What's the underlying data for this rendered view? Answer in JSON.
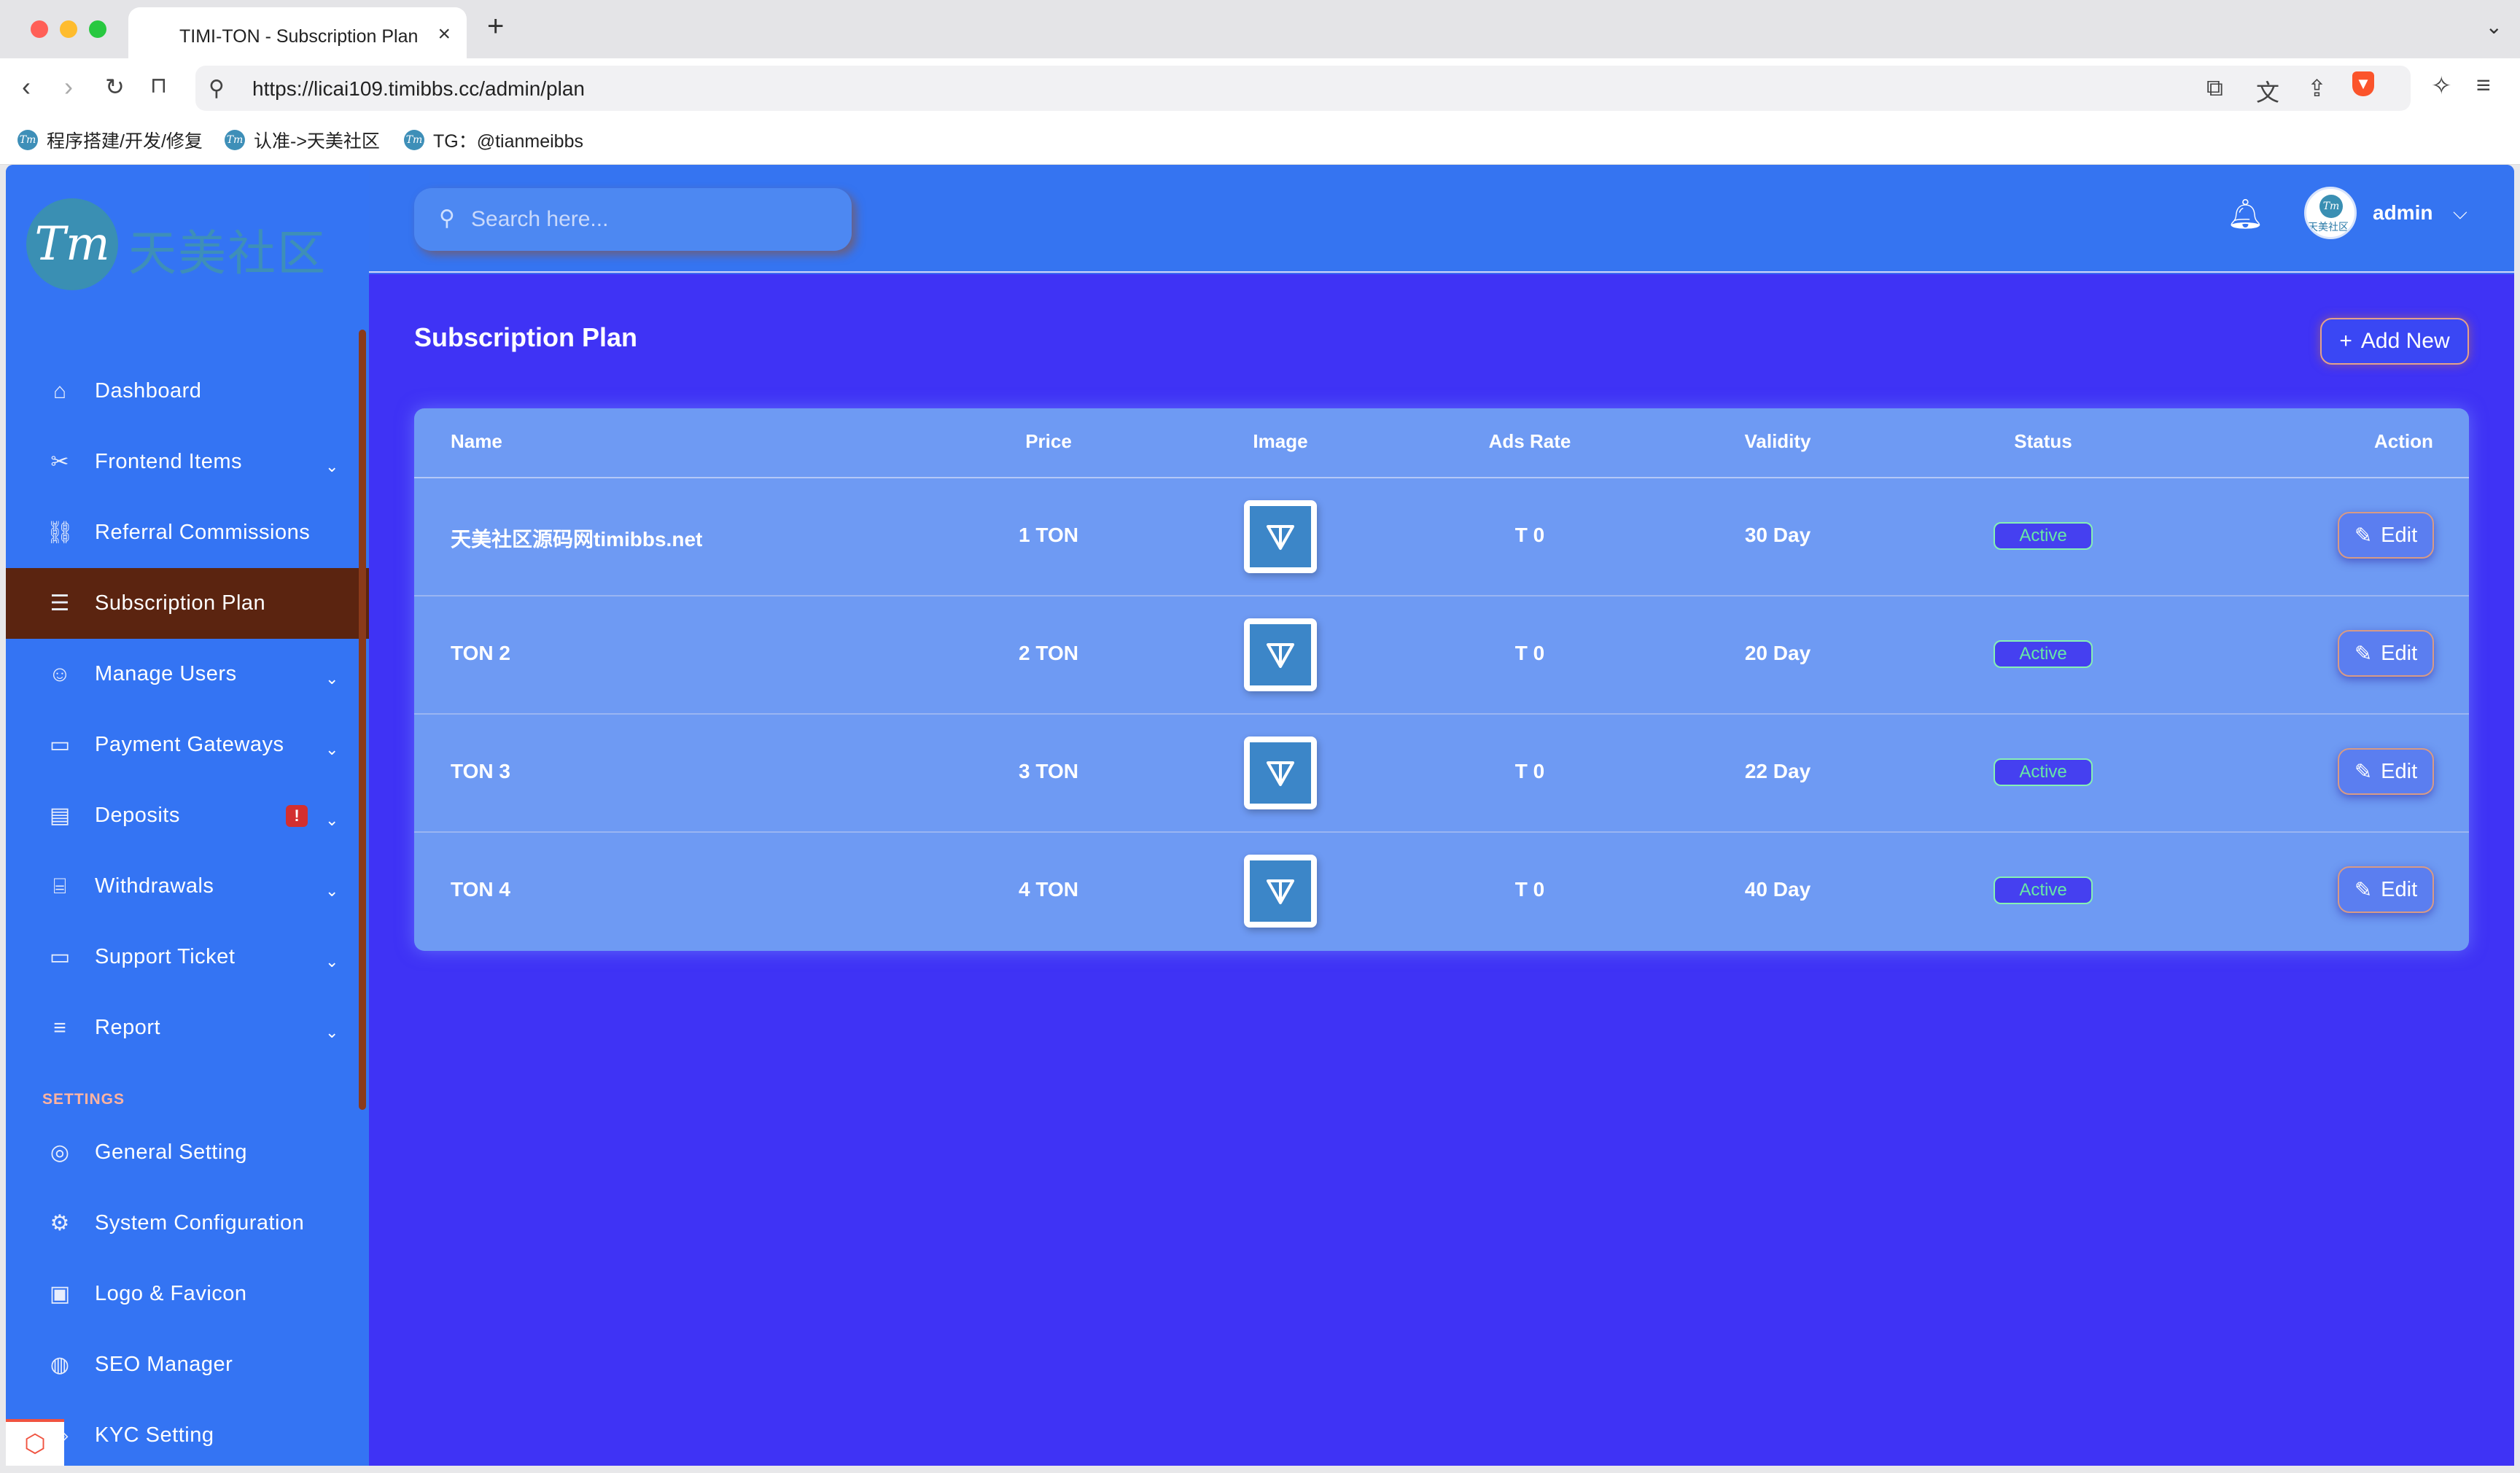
{
  "browser": {
    "tab_title": "TIMI-TON - Subscription Plan",
    "url": "https://licai109.timibbs.cc/admin/plan",
    "bookmarks": [
      "程序搭建/开发/修复",
      "认准->天美社区",
      "TG：@tianmeibbs"
    ]
  },
  "brand": {
    "logo_text": "天美社区",
    "logo_mark": "Tm"
  },
  "header": {
    "search_placeholder": "Search here...",
    "user_name": "admin",
    "avatar_text": "天美社区",
    "avatar_mark": "Tm"
  },
  "sidebar": {
    "items": [
      {
        "label": "Dashboard",
        "icon": "home-icon",
        "glyph": "⌂",
        "chevron": false,
        "active": false
      },
      {
        "label": "Frontend Items",
        "icon": "tools-icon",
        "glyph": "✂",
        "chevron": true,
        "active": false
      },
      {
        "label": "Referral Commissions",
        "icon": "link-icon",
        "glyph": "⛓",
        "chevron": false,
        "active": false
      },
      {
        "label": "Subscription Plan",
        "icon": "list-icon",
        "glyph": "☰",
        "chevron": false,
        "active": true
      },
      {
        "label": "Manage Users",
        "icon": "users-icon",
        "glyph": "☺",
        "chevron": true,
        "active": false
      },
      {
        "label": "Payment Gateways",
        "icon": "card-icon",
        "glyph": "▭",
        "chevron": true,
        "active": false
      },
      {
        "label": "Deposits",
        "icon": "deposit-icon",
        "glyph": "▤",
        "chevron": true,
        "active": false,
        "badge": "!"
      },
      {
        "label": "Withdrawals",
        "icon": "bank-icon",
        "glyph": "⌸",
        "chevron": true,
        "active": false
      },
      {
        "label": "Support Ticket",
        "icon": "ticket-icon",
        "glyph": "▭",
        "chevron": true,
        "active": false
      },
      {
        "label": "Report",
        "icon": "report-icon",
        "glyph": "≡",
        "chevron": true,
        "active": false
      }
    ],
    "settings_heading": "SETTINGS",
    "settings_items": [
      {
        "label": "General Setting",
        "icon": "lifebuoy-icon",
        "glyph": "◎"
      },
      {
        "label": "System Configuration",
        "icon": "gear-icon",
        "glyph": "⚙"
      },
      {
        "label": "Logo & Favicon",
        "icon": "image-icon",
        "glyph": "▣"
      },
      {
        "label": "SEO Manager",
        "icon": "globe-icon",
        "glyph": "◍"
      },
      {
        "label": "KYC Setting",
        "icon": "kyc-icon",
        "glyph": "◈"
      }
    ]
  },
  "main": {
    "page_title": "Subscription Plan",
    "add_button": "Add New",
    "table": {
      "columns": [
        "Name",
        "Price",
        "Image",
        "Ads Rate",
        "Validity",
        "Status",
        "Action"
      ],
      "rows": [
        {
          "name": "天美社区源码网timibbs.net",
          "price": "1 TON",
          "ads_rate": "T 0",
          "validity": "30 Day",
          "status": "Active",
          "action": "Edit"
        },
        {
          "name": "TON 2",
          "price": "2 TON",
          "ads_rate": "T 0",
          "validity": "20 Day",
          "status": "Active",
          "action": "Edit"
        },
        {
          "name": "TON 3",
          "price": "3 TON",
          "ads_rate": "T 0",
          "validity": "22 Day",
          "status": "Active",
          "action": "Edit"
        },
        {
          "name": "TON 4",
          "price": "4 TON",
          "ads_rate": "T 0",
          "validity": "40 Day",
          "status": "Active",
          "action": "Edit"
        }
      ]
    }
  },
  "colors": {
    "sidebar_bg": "#3474f3",
    "main_bg": "#3f33f5",
    "active_item_bg": "#5b2410",
    "status_active": "#67e8a6"
  }
}
